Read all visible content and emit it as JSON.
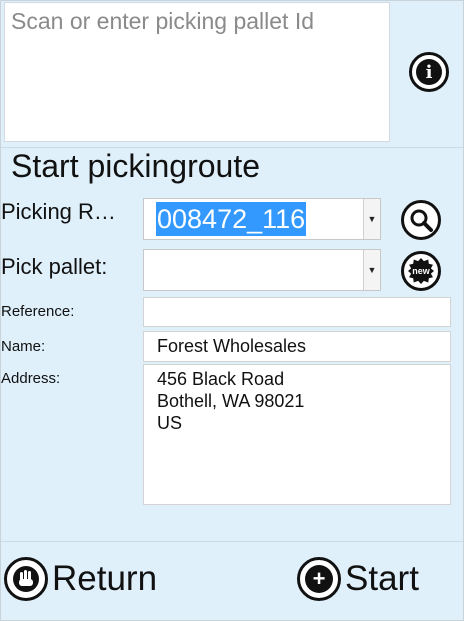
{
  "scan": {
    "placeholder": "Scan or enter picking pallet Id"
  },
  "title": "Start pickingroute",
  "form": {
    "picking_route_label": "Picking R…",
    "picking_route_value": "008472_116",
    "pick_pallet_label": "Pick pallet:",
    "pick_pallet_value": "",
    "reference_label": "Reference:",
    "reference_value": "",
    "name_label": "Name:",
    "name_value": "Forest Wholesales",
    "address_label": "Address:",
    "address_lines": [
      "456 Black Road",
      "Bothell, WA 98021",
      "US"
    ]
  },
  "icons": {
    "info": "info-icon",
    "search": "search-icon",
    "new": "new-badge-icon",
    "return": "hand-stop-icon",
    "start": "plus-icon",
    "new_badge_text": "new"
  },
  "footer": {
    "return_label": "Return",
    "start_label": "Start"
  }
}
